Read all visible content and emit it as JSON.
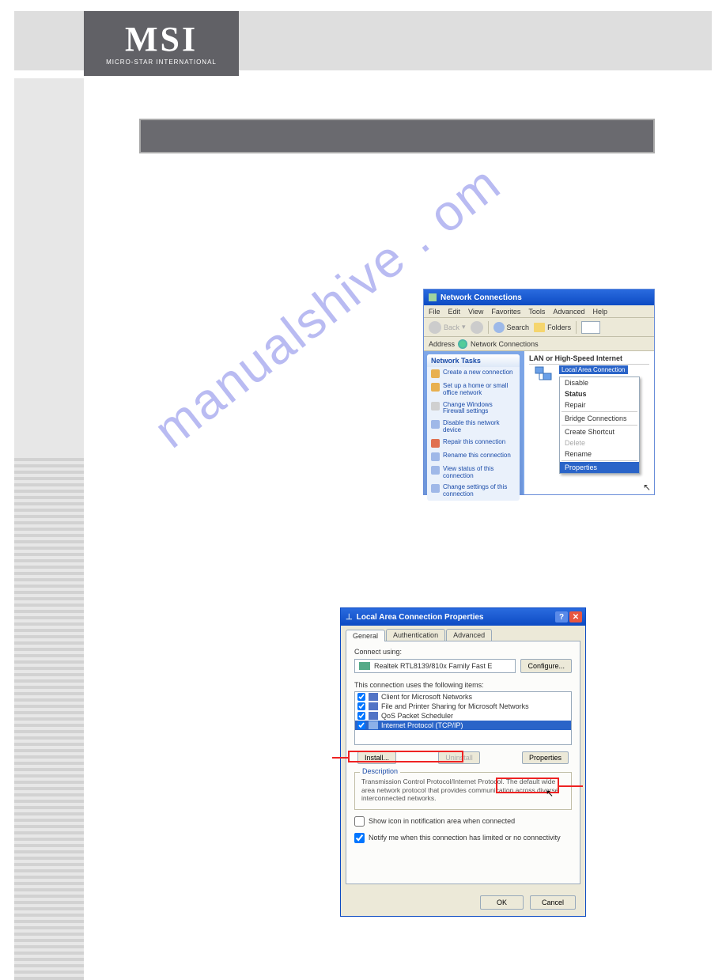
{
  "logo": {
    "main": "MSI",
    "sub": "MICRO-STAR INTERNATIONAL"
  },
  "watermark": "manualshive . om",
  "nc": {
    "title": "Network Connections",
    "menu": [
      "File",
      "Edit",
      "View",
      "Favorites",
      "Tools",
      "Advanced",
      "Help"
    ],
    "toolbar": {
      "back": "Back",
      "search": "Search",
      "folders": "Folders"
    },
    "address_label": "Address",
    "address_value": "Network Connections",
    "side_head": "Network Tasks",
    "side_items": [
      "Create a new connection",
      "Set up a home or small office network",
      "Change Windows Firewall settings",
      "Disable this network device",
      "Repair this connection",
      "Rename this connection",
      "View status of this connection",
      "Change settings of this connection"
    ],
    "group": "LAN or High-Speed Internet",
    "conn_label": "Local Area Connection",
    "ctx": {
      "disable": "Disable",
      "status": "Status",
      "repair": "Repair",
      "bridge": "Bridge Connections",
      "shortcut": "Create Shortcut",
      "delete": "Delete",
      "rename": "Rename",
      "properties": "Properties"
    }
  },
  "lacp": {
    "title": "Local Area Connection Properties",
    "tabs": [
      "General",
      "Authentication",
      "Advanced"
    ],
    "connect_using": "Connect using:",
    "adapter": "Realtek RTL8139/810x Family Fast E",
    "configure": "Configure...",
    "uses_label": "This connection uses the following items:",
    "items": [
      "Client for Microsoft Networks",
      "File and Printer Sharing for Microsoft Networks",
      "QoS Packet Scheduler",
      "Internet Protocol (TCP/IP)"
    ],
    "install": "Install...",
    "uninstall": "Uninstall",
    "properties": "Properties",
    "desc_head": "Description",
    "desc_text": "Transmission Control Protocol/Internet Protocol. The default wide area network protocol that provides communication across diverse interconnected networks.",
    "chk1": "Show icon in notification area when connected",
    "chk2": "Notify me when this connection has limited or no connectivity",
    "ok": "OK",
    "cancel": "Cancel"
  }
}
